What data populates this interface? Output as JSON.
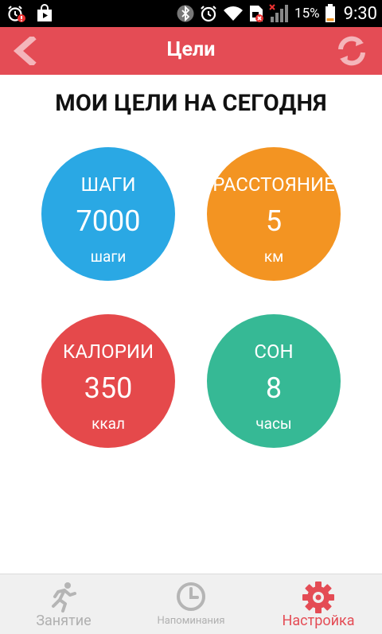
{
  "status_bar": {
    "battery_percent": "15%",
    "time": "9:30",
    "icons": [
      "alarm-icon",
      "play-store-icon",
      "bluetooth-icon",
      "alarm-clock-icon",
      "wifi-icon",
      "sim-icon",
      "signal-icon",
      "battery-icon"
    ]
  },
  "app_bar": {
    "title": "Цели",
    "back_icon": "chevron-left-icon",
    "refresh_icon": "refresh-icon",
    "color": "#e44c55"
  },
  "page_title": "МОИ ЦЕЛИ НА СЕГОДНЯ",
  "goals": [
    {
      "label": "ШАГИ",
      "value": "7000",
      "unit": "шаги",
      "color": "#2aa8e4"
    },
    {
      "label": "РАССТОЯНИЕ",
      "value": "5",
      "unit": "км",
      "color": "#f39422"
    },
    {
      "label": "КАЛОРИИ",
      "value": "350",
      "unit": "ккал",
      "color": "#e5494b"
    },
    {
      "label": "СОН",
      "value": "8",
      "unit": "часы",
      "color": "#36b995"
    }
  ],
  "bottom_nav": {
    "items": [
      {
        "label": "Занятие",
        "icon": "running-person-icon",
        "active": false
      },
      {
        "label": "Напоминания",
        "icon": "clock-icon",
        "active": false
      },
      {
        "label": "Настройка",
        "icon": "gear-icon",
        "active": true
      }
    ]
  }
}
